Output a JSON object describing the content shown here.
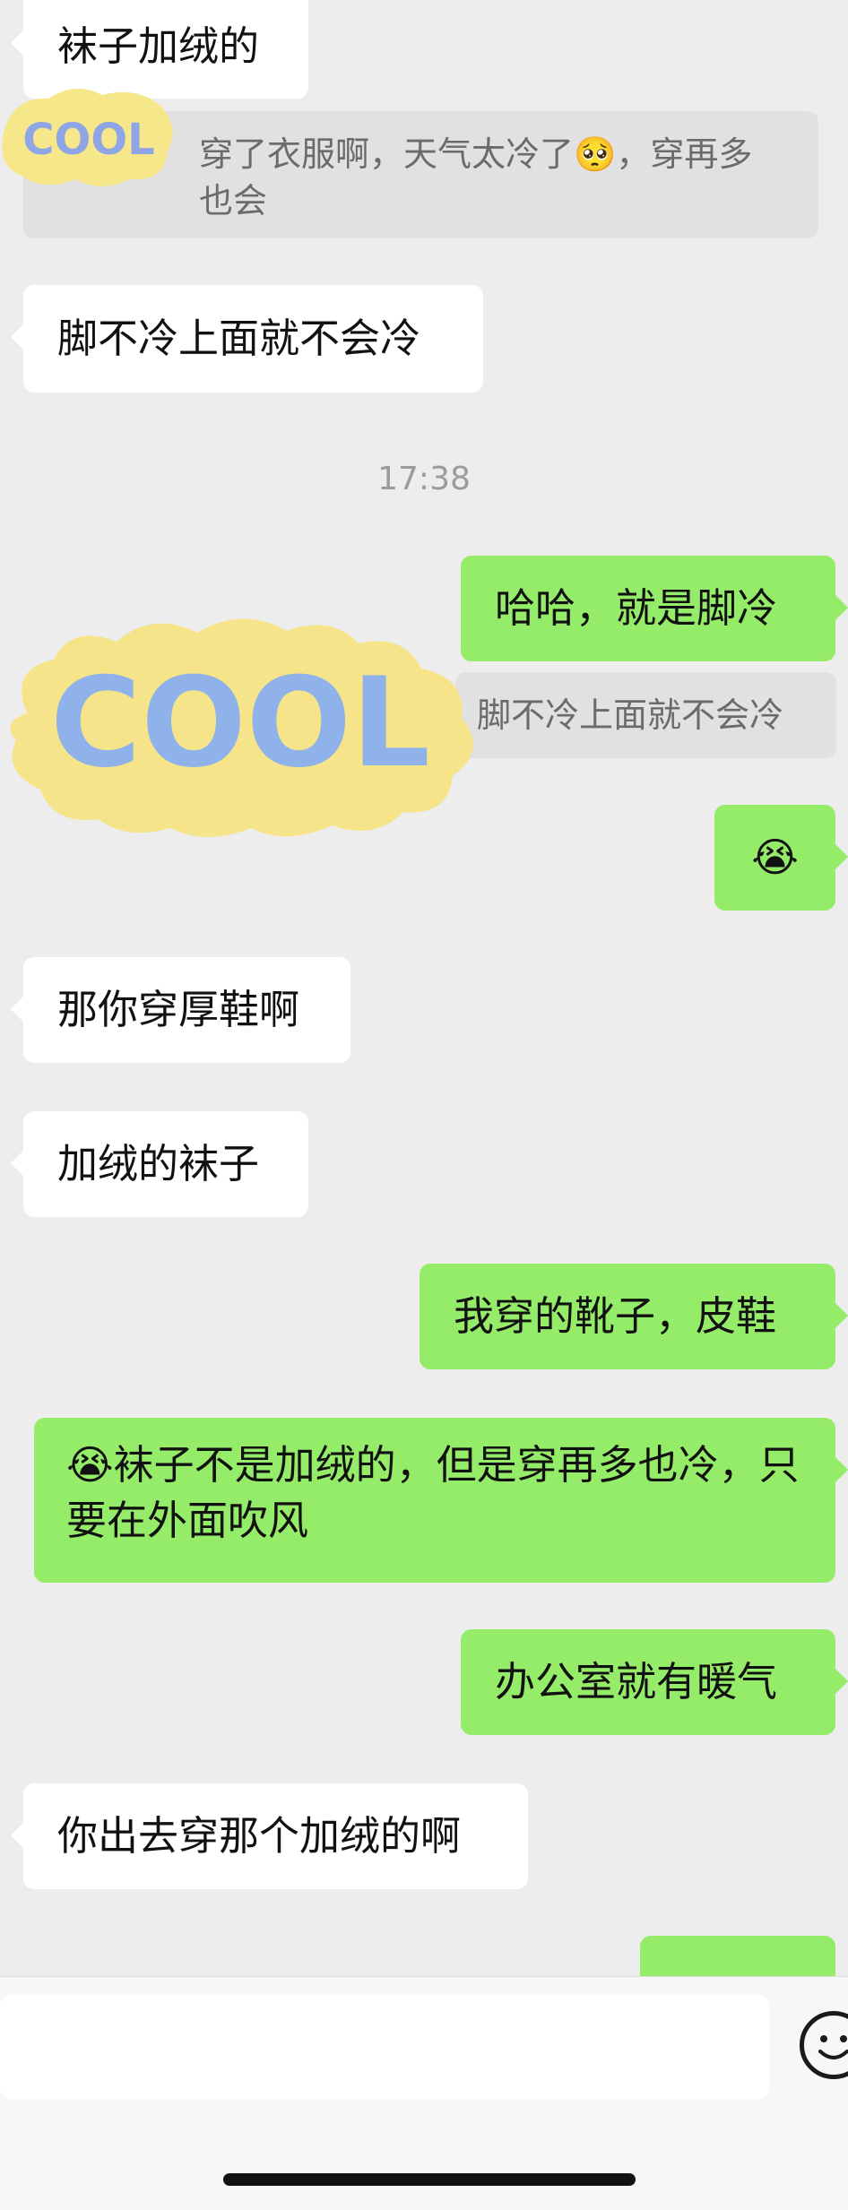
{
  "chat": {
    "timestamp": "17:38",
    "messages": {
      "m1": "袜子加绒的",
      "m2_quote": "穿了衣服啊，天气太冷了🥺，穿再多也会",
      "m3": "脚不冷上面就不会冷",
      "m4": "哈哈，就是脚冷",
      "m4_quote": "脚不冷上面就不会冷",
      "m5_emoji": "😭",
      "m6": "那你穿厚鞋啊",
      "m7": "加绒的袜子",
      "m8": "我穿的靴子，皮鞋",
      "m9": "😭袜子不是加绒的，但是穿再多也冷，只要在外面吹风",
      "m10": "办公室就有暖气",
      "m11": "你出去穿那个加绒的啊"
    },
    "stickers": {
      "cool_text": "COOL"
    }
  },
  "colors": {
    "background": "#ededed",
    "bubble_in": "#ffffff",
    "bubble_out": "#95ec69",
    "quote_bg": "#e1e1e1",
    "timestamp": "#9b9b9b"
  },
  "icons": {
    "emoji_button": "smiley-face-icon"
  }
}
